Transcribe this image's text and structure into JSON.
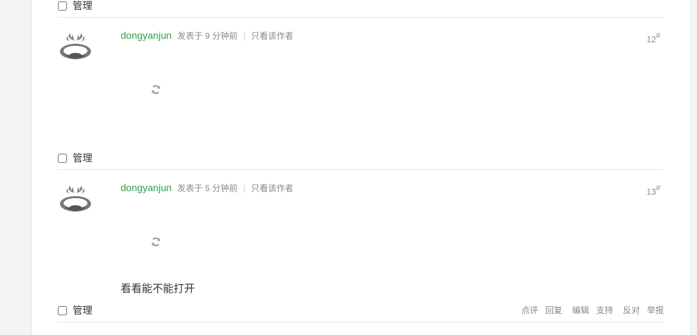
{
  "posts": [
    {
      "manage_label": "管理",
      "author": "dongyanjun",
      "posted_at": "发表于 9 分钟前",
      "separator": "|",
      "only_author_label": "只看该作者",
      "floor_number": "12",
      "floor_suffix": "#",
      "text": "",
      "manage_label_bottom": "管理"
    },
    {
      "author": "dongyanjun",
      "posted_at": "发表于 5 分钟前",
      "separator": "|",
      "only_author_label": "只看该作者",
      "floor_number": "13",
      "floor_suffix": "#",
      "text": "看看能不能打开",
      "manage_label_bottom": "管理",
      "actions": [
        "点评",
        "回复",
        "编辑",
        "支持",
        "反对",
        "举报"
      ]
    }
  ],
  "top_manage_label": "管理",
  "colors": {
    "author": "#2aa147",
    "meta": "#888888",
    "divider": "#e5e5e5",
    "page_bg": "#f3f3f3"
  },
  "icons": {
    "avatar": "deer-antler-avatar-icon",
    "loading": "refresh-loading-icon"
  }
}
